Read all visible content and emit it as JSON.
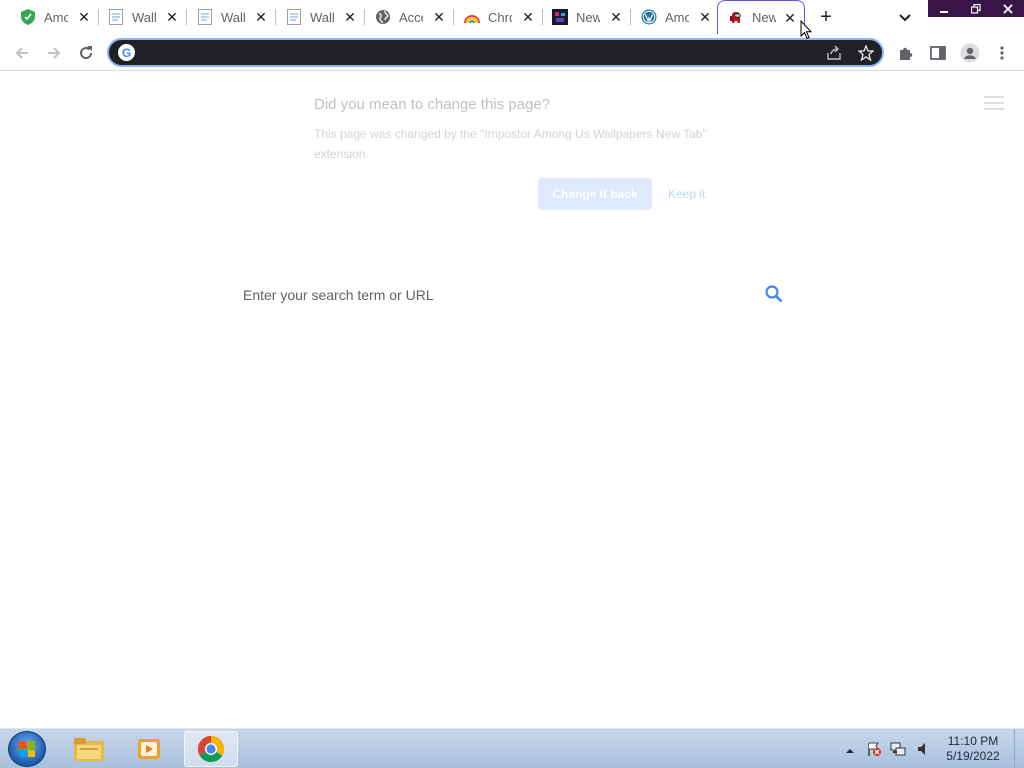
{
  "tabs": [
    {
      "title": "Amo",
      "favicon": "shield-icon",
      "active": false
    },
    {
      "title": "Wall",
      "favicon": "document-icon",
      "active": false
    },
    {
      "title": "Wall",
      "favicon": "document-icon",
      "active": false
    },
    {
      "title": "Wall",
      "favicon": "document-icon",
      "active": false
    },
    {
      "title": "Acce",
      "favicon": "globe-icon",
      "active": false
    },
    {
      "title": "Chro",
      "favicon": "rainbow-icon",
      "active": false
    },
    {
      "title": "New",
      "favicon": "dark-square-icon",
      "active": false
    },
    {
      "title": "Amo",
      "favicon": "wordpress-icon",
      "active": false
    },
    {
      "title": "New",
      "favicon": "among-us-icon",
      "active": true
    }
  ],
  "omnibox": {
    "value": "",
    "placeholder": ""
  },
  "bubble": {
    "title": "Did you mean to change this page?",
    "body": "This page was changed by the \"Impostor Among Us Wallpapers New Tab\" extension.",
    "primary": "Change it back",
    "secondary": "Keep it"
  },
  "search": {
    "placeholder": "Enter your search term or URL"
  },
  "taskbar": {
    "time": "11:10 PM",
    "date": "5/19/2022"
  },
  "colors": {
    "accent": "#8ab4f8",
    "omnibox_bg": "#202124",
    "winctl_bg": "#3a1347"
  }
}
